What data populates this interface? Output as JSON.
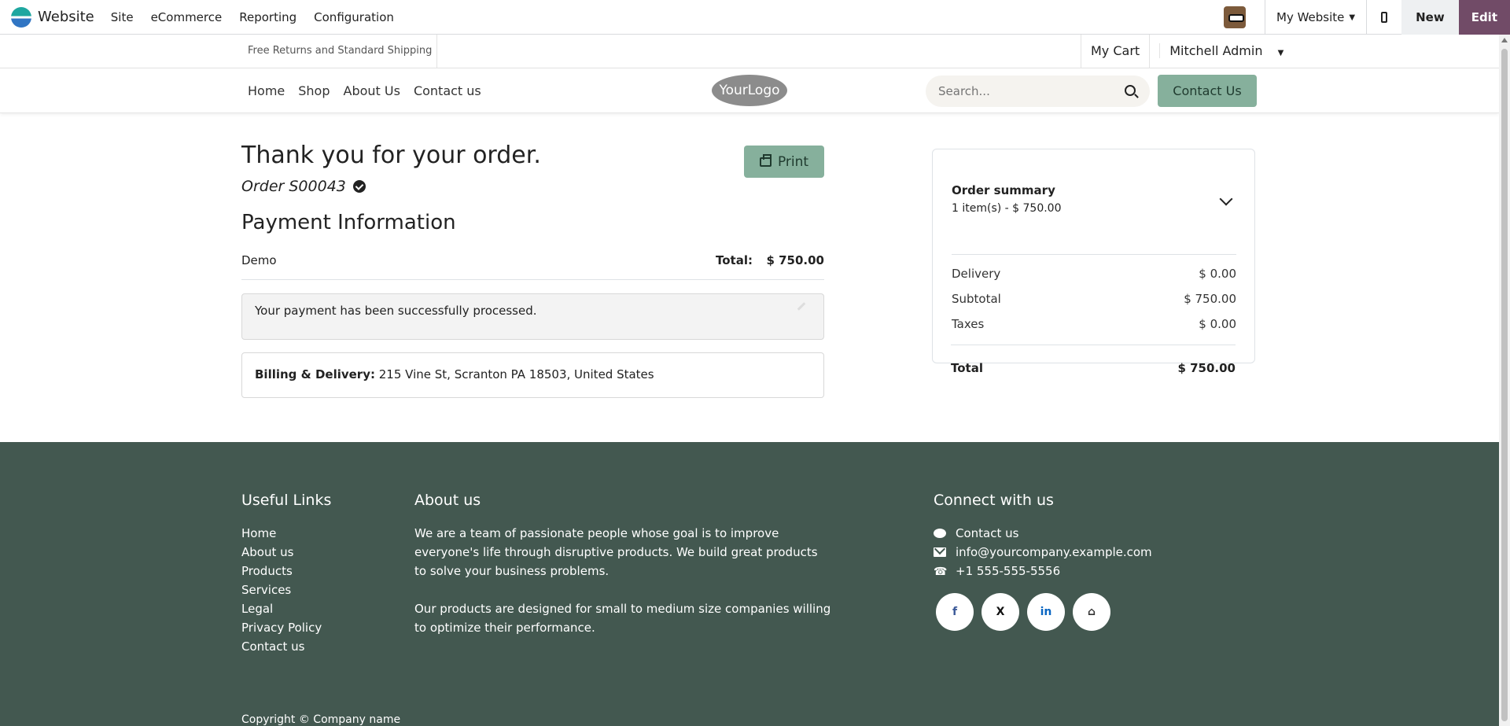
{
  "admin_bar": {
    "app_name": "Website",
    "menu": [
      "Site",
      "eCommerce",
      "Reporting",
      "Configuration"
    ],
    "website_selector": "My Website",
    "new_label": "New",
    "edit_label": "Edit"
  },
  "header": {
    "promo": "Free Returns and Standard Shipping",
    "cart_label": "My Cart",
    "user_label": "Mitchell Admin",
    "nav": [
      "Home",
      "Shop",
      "About Us",
      "Contact us"
    ],
    "logo_text": "YourLogo",
    "search_placeholder": "Search...",
    "contact_button": "Contact Us"
  },
  "confirmation": {
    "title": "Thank you for your order.",
    "order_ref": "Order S00043",
    "print_label": "Print",
    "payment_heading": "Payment Information",
    "payment_method": "Demo",
    "total_label": "Total:",
    "total_value": "$ 750.00",
    "alert_message": "Your payment has been successfully processed.",
    "billing_label": "Billing & Delivery:",
    "billing_address": " 215 Vine St, Scranton PA 18503, United States"
  },
  "summary": {
    "title": "Order summary",
    "subtitle": "1 item(s) -  $ 750.00",
    "rows": [
      {
        "label": "Delivery",
        "value": "$ 0.00"
      },
      {
        "label": "Subtotal",
        "value": "$ 750.00"
      },
      {
        "label": "Taxes",
        "value": "$ 0.00"
      }
    ],
    "total_label": "Total",
    "total_value": "$ 750.00"
  },
  "footer": {
    "links_heading": "Useful Links",
    "links": [
      "Home",
      "About us",
      "Products",
      "Services",
      "Legal",
      "Privacy Policy",
      "Contact us"
    ],
    "about_heading": "About us",
    "about_p1": "We are a team of passionate people whose goal is to improve everyone's life through disruptive products. We build great products to solve your business problems.",
    "about_p2": "Our products are designed for small to medium size companies willing to optimize their performance.",
    "connect_heading": "Connect with us",
    "contact_link": "Contact us",
    "email": "info@yourcompany.example.com",
    "phone": "+1 555-555-5556",
    "socials": [
      "facebook-icon",
      "x-icon",
      "linkedin-icon",
      "home-icon"
    ],
    "social_glyphs": [
      "f",
      "X",
      "in",
      "⌂"
    ],
    "copyright": "Copyright © Company name"
  },
  "colors": {
    "accent": "#714b67",
    "button_green": "#86b09c",
    "footer_bg": "#435850"
  }
}
